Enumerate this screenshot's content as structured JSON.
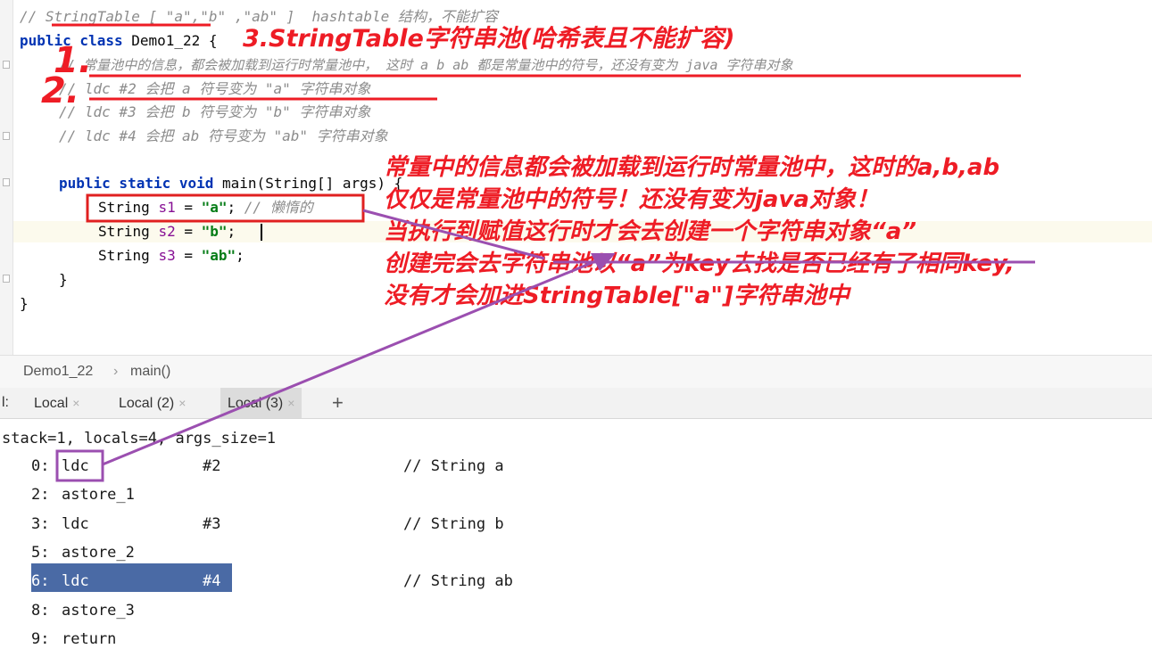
{
  "editor": {
    "comment_top": "// StringTable [ \"a\",\"b\" ,\"ab\" ]  hashtable 结构，不能扩容",
    "class_kw": "public class",
    "class_name": " Demo1_22 {",
    "comment1": "// 常量池中的信息，都会被加载到运行时常量池中， 这时 a b ab 都是常量池中的符号，还没有变为 java 字符串对象",
    "comment2": "// ldc #2 会把 a 符号变为 \"a\" 字符串对象",
    "comment3": "// ldc #3 会把 b 符号变为 \"b\" 字符串对象",
    "comment4": "// ldc #4 会把 ab 符号变为 \"ab\" 字符串对象",
    "main_kw": "public static void",
    "main_sig": " main(String[] args) {",
    "lines": [
      {
        "type": "String ",
        "var": "s1",
        "eq": " = ",
        "val": "\"a\"",
        "end": ";",
        "cmt": " // 懒惰的"
      },
      {
        "type": "String ",
        "var": "s2",
        "eq": " = ",
        "val": "\"b\"",
        "end": ";",
        "cmt": ""
      },
      {
        "type": "String ",
        "var": "s3",
        "eq": " = ",
        "val": "\"ab\"",
        "end": ";",
        "cmt": ""
      }
    ],
    "close_inner": "}",
    "close_outer": "}"
  },
  "annotations": {
    "title": "3.StringTable字符串池(哈希表且不能扩容)",
    "num1": "1.",
    "num2": "2.",
    "overlay": [
      "常量中的信息都会被加载到运行时常量池中，这时的a,b,ab",
      "仅仅是常量池中的符号！还没有变为java对象！",
      "当执行到赋值这行时才会去创建一个字符串对象“a”",
      "创建完会去字符串池以“a”为key去找是否已经有了相同key,",
      "没有才会加进StringTable[\"a\"]字符串池中"
    ],
    "color": "#ee1c25",
    "arrow_color": "#9b4fb0"
  },
  "breadcrumb": {
    "items": [
      "Demo1_22",
      "main()"
    ],
    "separator": "›"
  },
  "tabs": {
    "prefix": "l:",
    "items": [
      {
        "label": "Local",
        "close": "×"
      },
      {
        "label": "Local (2)",
        "close": "×"
      },
      {
        "label": "Local (3)",
        "close": "×"
      }
    ],
    "add": "+"
  },
  "terminal": {
    "header": "stack=1, locals=4, args_size=1",
    "rows": [
      {
        "off": "0:",
        "op": "ldc",
        "arg": "#2",
        "cmt": "// String a"
      },
      {
        "off": "2:",
        "op": "astore_1",
        "arg": "",
        "cmt": ""
      },
      {
        "off": "3:",
        "op": "ldc",
        "arg": "#3",
        "cmt": "// String b"
      },
      {
        "off": "5:",
        "op": "astore_2",
        "arg": "",
        "cmt": ""
      },
      {
        "off": "6:",
        "op": "ldc",
        "arg": "#4",
        "cmt": "// String ab"
      },
      {
        "off": "8:",
        "op": "astore_3",
        "arg": "",
        "cmt": ""
      },
      {
        "off": "9:",
        "op": "return",
        "arg": "",
        "cmt": ""
      }
    ],
    "highlight_color": "#4a6aa5"
  }
}
